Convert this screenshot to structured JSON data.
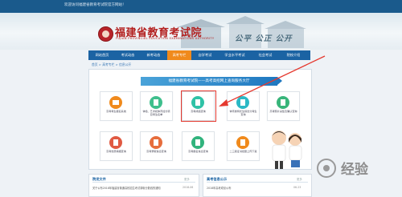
{
  "topbar": {
    "text": "欢迎访问福建省教育考试院官方网站！"
  },
  "header": {
    "title": "福建省教育考试院",
    "subtitle": "FUJIAN PROVINCIAL EDUCATION EXAMINATIONS AUTHORITY",
    "slogan": "公平  公正  公开"
  },
  "nav": {
    "items": [
      {
        "label": "网站首页"
      },
      {
        "label": "考试动态"
      },
      {
        "label": "新考动态"
      },
      {
        "label": "高考专栏"
      },
      {
        "label": "自学考试"
      },
      {
        "label": "学业水平考试"
      },
      {
        "label": "社会考试"
      },
      {
        "label": "院校介绍"
      }
    ],
    "active_index": 3
  },
  "breadcrumb": "首页 > 高考专栏 > 信息公开",
  "ribbon": "福建省教育考试院——高考高招网上查询服务大厅",
  "cards": [
    {
      "label": "高考考生报名系统",
      "color": "#f08a1c"
    },
    {
      "label": "体检、艺术和体育加分项目考生名单",
      "color": "#3fbf8d"
    },
    {
      "label": "高考成绩查询",
      "color": "#2fc2a6"
    },
    {
      "label": "体育类特长生综合分考生查询",
      "color": "#2bb8c5"
    },
    {
      "label": "高考照片采集及确认查询",
      "color": "#38b57a"
    },
    {
      "label": "高考志愿填报查询",
      "color": "#e05a42"
    },
    {
      "label": "高考录取信息查询",
      "color": "#e66d3c"
    },
    {
      "label": "高考报名信息查询",
      "color": "#31b37d"
    },
    {
      "label": "二三级证书批量上传下载",
      "color": "#f08a1c"
    }
  ],
  "notices": [
    {
      "title": "院发文件",
      "more": "更多",
      "items": [
        {
          "text": "关于公布2018年福建省普通高校招生考试录取分数线的通知",
          "date": "2018-06"
        }
      ]
    },
    {
      "title": "高考信息公示",
      "more": "更多",
      "items": [
        {
          "text": "2018年高考成绩公布",
          "date": "06-23"
        }
      ]
    }
  ],
  "watermark": "经验",
  "colors": {
    "nav": "#1b63a3",
    "active": "#f08a1c",
    "accent_red": "#e5392f",
    "title_red": "#b3201f"
  }
}
